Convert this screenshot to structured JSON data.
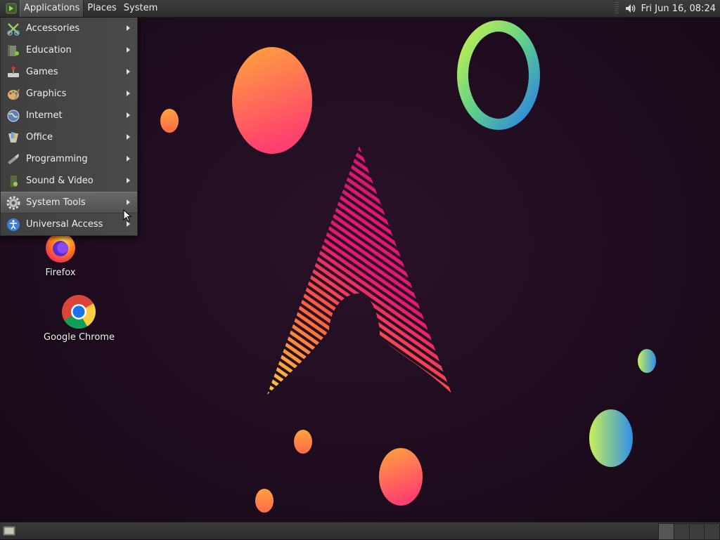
{
  "top_panel": {
    "menus": [
      "Applications",
      "Places",
      "System"
    ],
    "clock": "Fri Jun 16, 08:24",
    "volume_icon": "speaker-icon"
  },
  "app_menu": {
    "items": [
      {
        "label": "Accessories",
        "icon": "accessories-icon"
      },
      {
        "label": "Education",
        "icon": "education-icon"
      },
      {
        "label": "Games",
        "icon": "games-icon"
      },
      {
        "label": "Graphics",
        "icon": "graphics-icon"
      },
      {
        "label": "Internet",
        "icon": "internet-icon"
      },
      {
        "label": "Office",
        "icon": "office-icon"
      },
      {
        "label": "Programming",
        "icon": "programming-icon"
      },
      {
        "label": "Sound & Video",
        "icon": "sound-video-icon"
      },
      {
        "label": "System Tools",
        "icon": "system-tools-icon"
      },
      {
        "label": "Universal Access",
        "icon": "universal-access-icon"
      }
    ],
    "highlighted": "System Tools"
  },
  "desktop": {
    "icons": [
      {
        "label": "Firefox",
        "icon": "firefox-icon"
      },
      {
        "label": "Google Chrome",
        "icon": "chrome-icon"
      }
    ]
  },
  "colors": {
    "background": "#1e0c1e",
    "panel": "#333333",
    "accent_pink": "#e8186e",
    "accent_orange": "#ff8a3d",
    "accent_yellow": "#ffd23a"
  }
}
